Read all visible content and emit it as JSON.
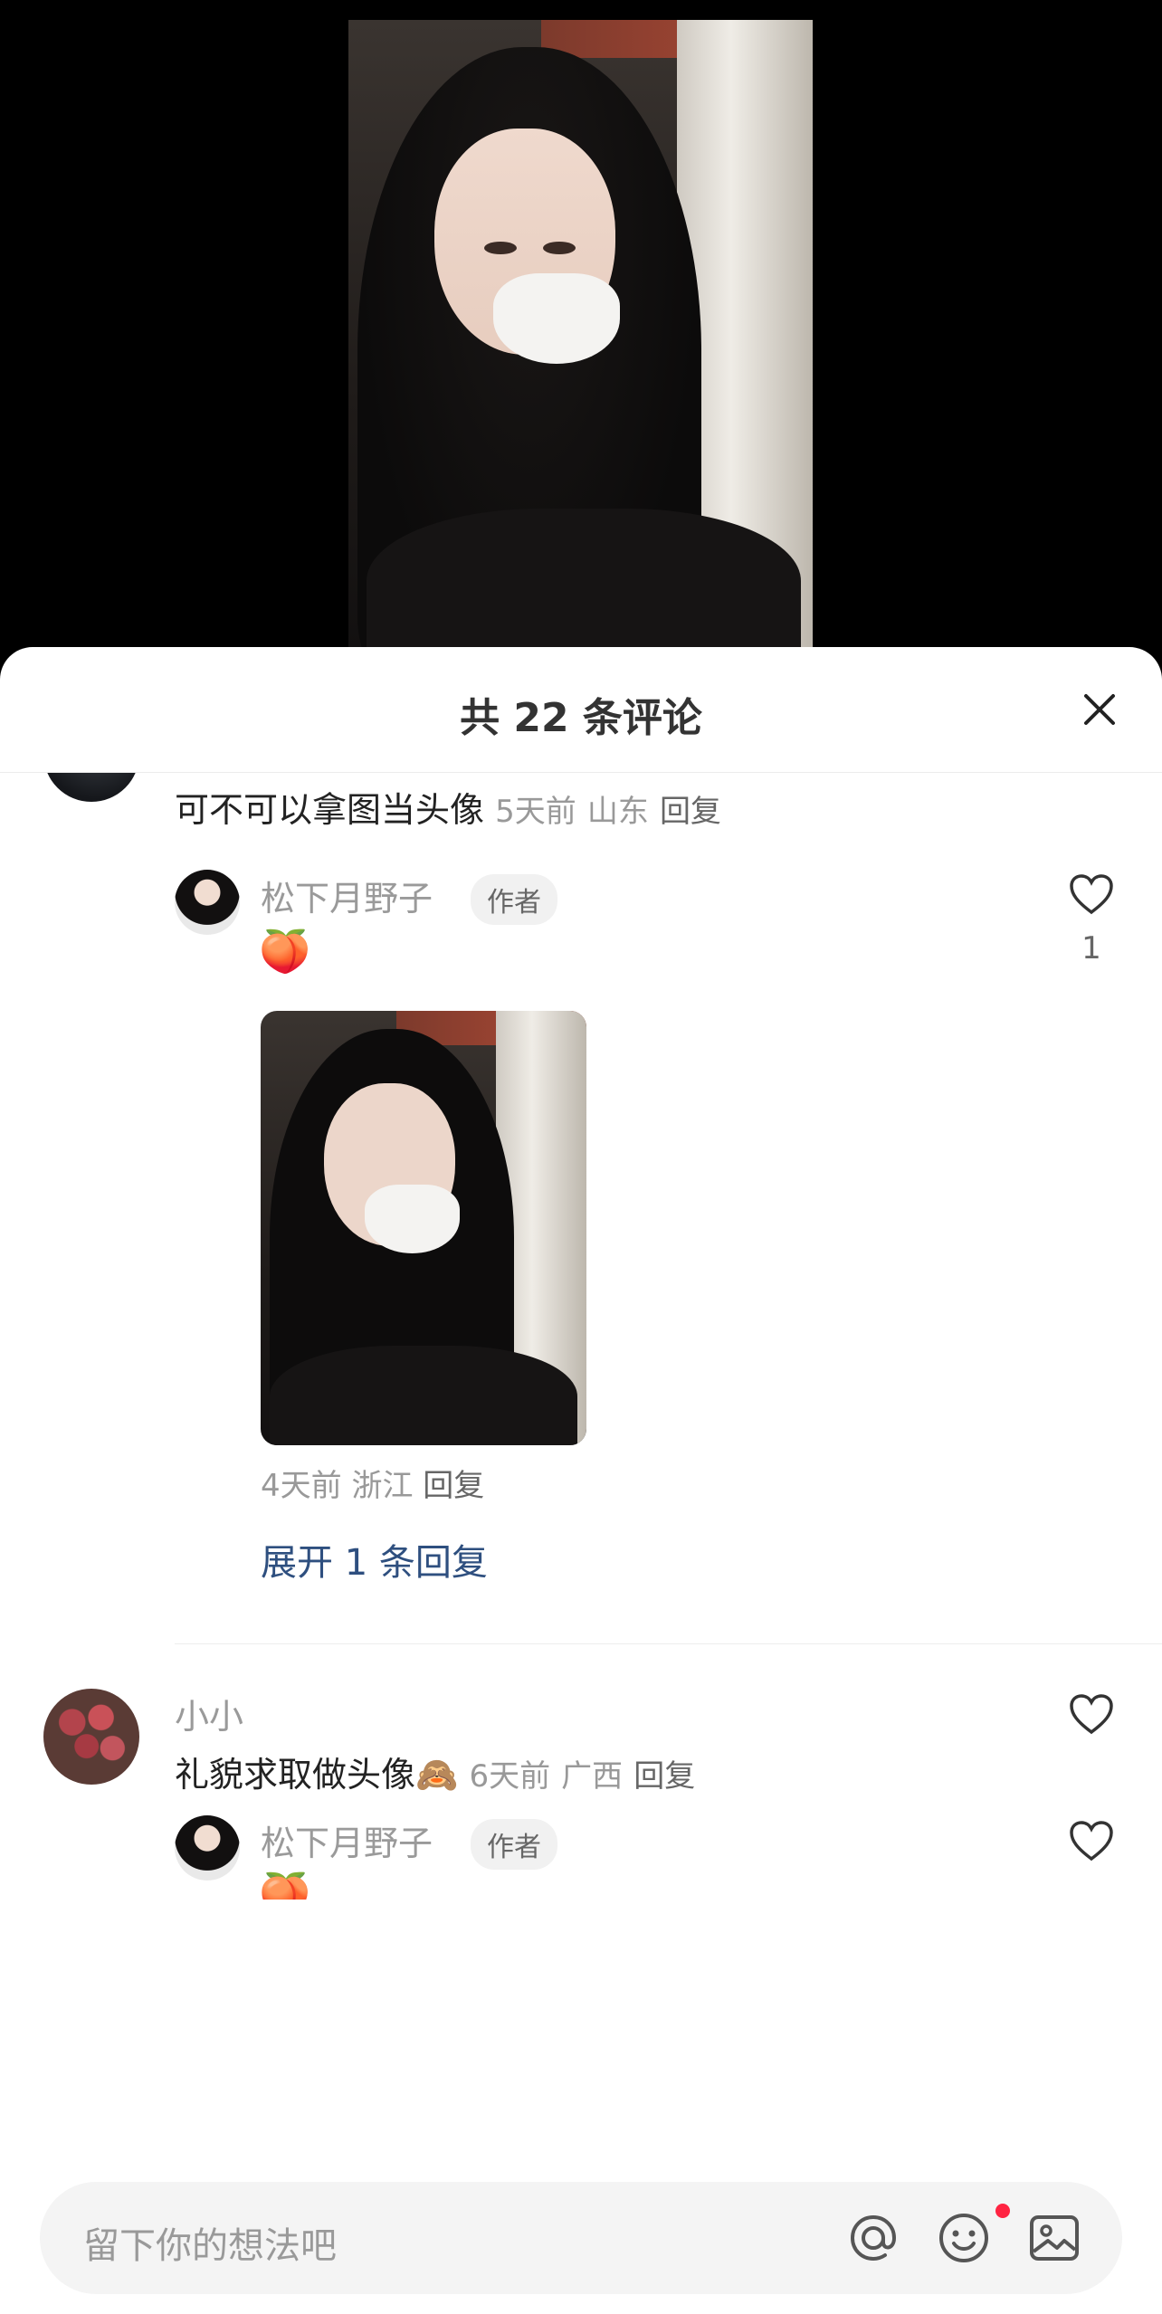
{
  "header": {
    "title": "共 22 条评论"
  },
  "comments": [
    {
      "text": "可不可以拿图当头像",
      "time": "5天前",
      "location": "山东",
      "reply_label": "回复",
      "reply": {
        "username": "松下月野子",
        "badge": "作者",
        "emoji": "🍑",
        "time": "4天前",
        "location": "浙江",
        "reply_label": "回复",
        "like_count": "1"
      },
      "expand_label": "展开 1 条回复"
    },
    {
      "username": "小小",
      "text": "礼貌求取做头像",
      "text_emoji": "🙈",
      "time": "6天前",
      "location": "广西",
      "reply_label": "回复",
      "reply": {
        "username": "松下月野子",
        "badge": "作者",
        "emoji": "🍑"
      }
    }
  ],
  "input": {
    "placeholder": "留下你的想法吧"
  },
  "icons": [
    "close-icon",
    "heart-icon",
    "at-icon",
    "emoji-icon",
    "image-icon"
  ],
  "colors": {
    "link": "#2e4f7f",
    "notification": "#ff2442"
  }
}
